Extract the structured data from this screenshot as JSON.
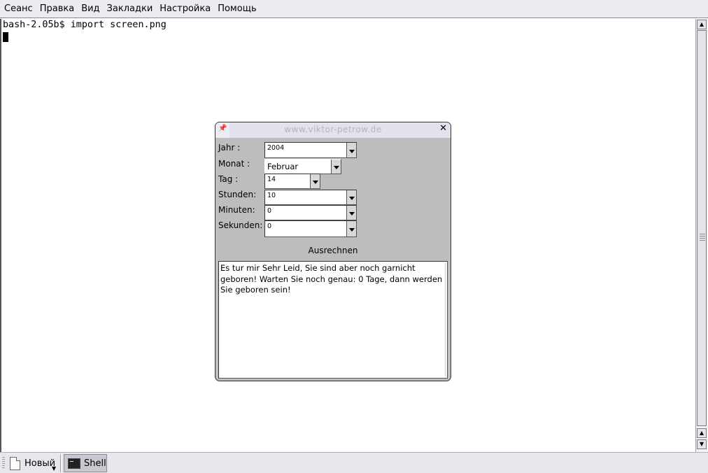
{
  "menu": [
    "Сеанс",
    "Правка",
    "Вид",
    "Закладки",
    "Настройка",
    "Помощь"
  ],
  "terminal": {
    "prompt_line": "bash-2.05b$ import screen.png"
  },
  "dialog": {
    "title": "www.viktor-petrow.de",
    "fields": {
      "jahr": {
        "label": "Jahr :",
        "value": "2004"
      },
      "monat": {
        "label": "Monat :",
        "value": "Februar"
      },
      "tag": {
        "label": "Tag :",
        "value": "14"
      },
      "stunden": {
        "label": "Stunden:",
        "value": "10"
      },
      "minuten": {
        "label": "Minuten:",
        "value": "0"
      },
      "sekunden": {
        "label": "Sekunden:",
        "value": "0"
      }
    },
    "calc_button": "Ausrechnen",
    "output_text": "Es tur mir Sehr Leid, Sie sind aber noch garnicht geboren! Warten Sie noch genau: 0 Tage, dann werden Sie geboren sein!"
  },
  "taskbar": {
    "new_label": "Новый",
    "shell_label": "Shell"
  },
  "icons": {
    "pin": "pin-icon",
    "close": "close-icon",
    "new_session": "document-icon",
    "terminal": "terminal-icon"
  }
}
